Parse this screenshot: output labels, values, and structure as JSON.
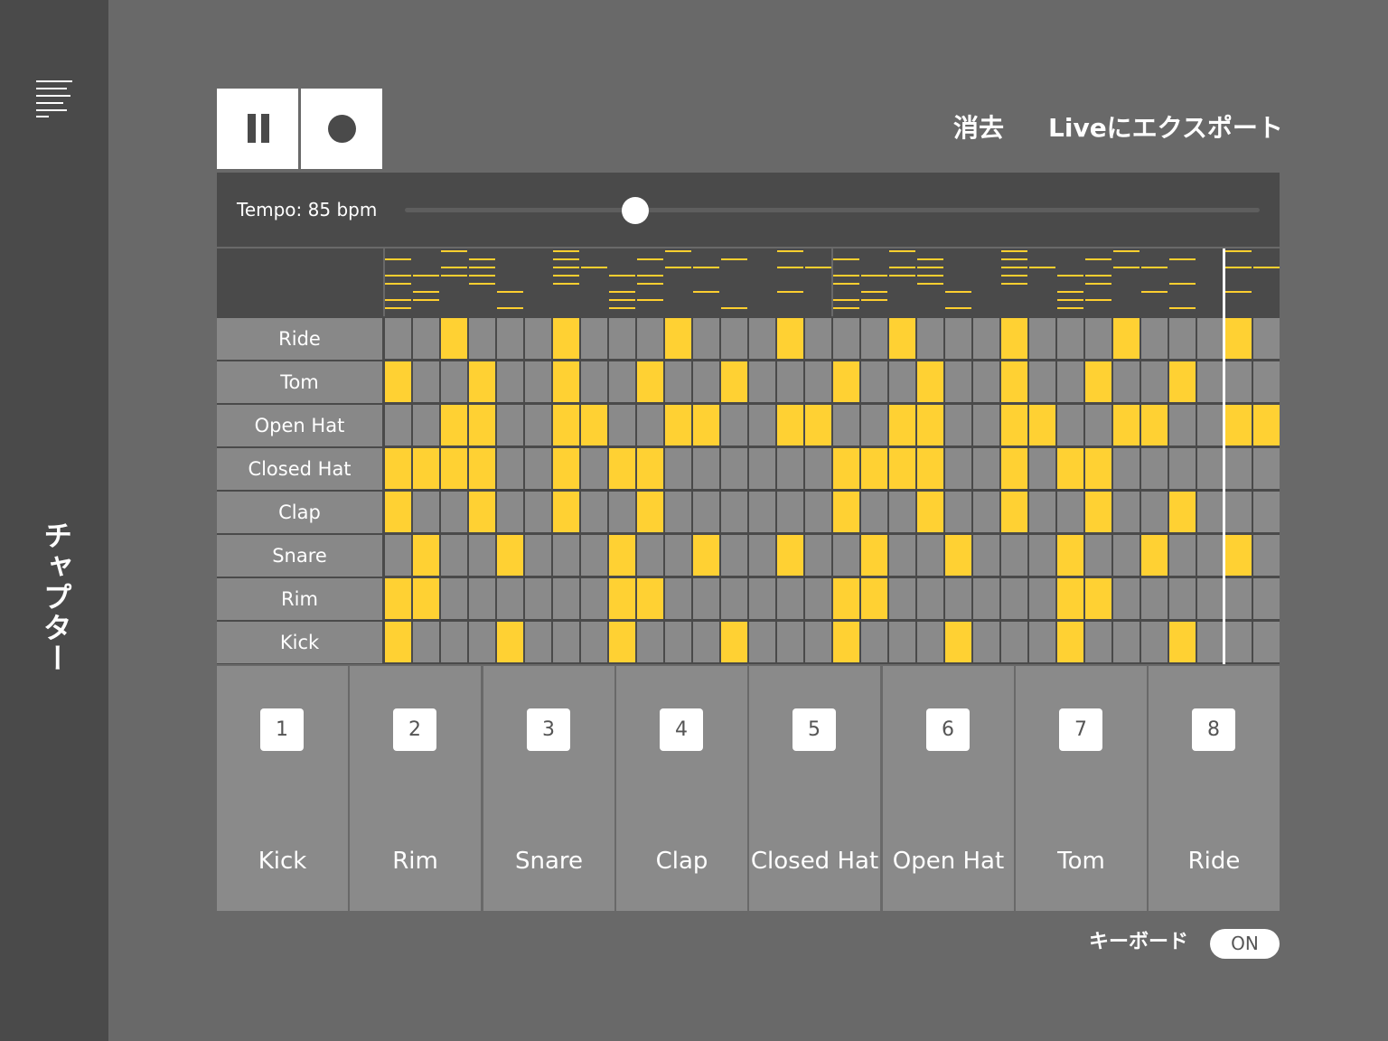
{
  "sidebar": {
    "menu_icon": "menu-icon",
    "chapter_label": "チャプター"
  },
  "transport": {
    "pause_icon": "pause-icon",
    "record_icon": "record-icon"
  },
  "actions": {
    "clear": "消去",
    "export": "Liveにエクスポート"
  },
  "tempo": {
    "label": "Tempo: 85 bpm",
    "value": 85,
    "slider_fraction": 0.27
  },
  "sequencer": {
    "steps": 32,
    "playhead_step": 30,
    "tracks": [
      {
        "name": "Ride",
        "steps": [
          0,
          0,
          1,
          0,
          0,
          0,
          1,
          0,
          0,
          0,
          1,
          0,
          0,
          0,
          1,
          0,
          0,
          0,
          1,
          0,
          0,
          0,
          1,
          0,
          0,
          0,
          1,
          0,
          0,
          0,
          1,
          0
        ]
      },
      {
        "name": "Tom",
        "steps": [
          1,
          0,
          0,
          1,
          0,
          0,
          1,
          0,
          0,
          1,
          0,
          0,
          1,
          0,
          0,
          0,
          1,
          0,
          0,
          1,
          0,
          0,
          1,
          0,
          0,
          1,
          0,
          0,
          1,
          0,
          0,
          0
        ]
      },
      {
        "name": "Open Hat",
        "steps": [
          0,
          0,
          1,
          1,
          0,
          0,
          1,
          1,
          0,
          0,
          1,
          1,
          0,
          0,
          1,
          1,
          0,
          0,
          1,
          1,
          0,
          0,
          1,
          1,
          0,
          0,
          1,
          1,
          0,
          0,
          1,
          1
        ]
      },
      {
        "name": "Closed Hat",
        "steps": [
          1,
          1,
          1,
          1,
          0,
          0,
          1,
          0,
          1,
          1,
          0,
          0,
          0,
          0,
          0,
          0,
          1,
          1,
          1,
          1,
          0,
          0,
          1,
          0,
          1,
          1,
          0,
          0,
          0,
          0,
          0,
          0
        ]
      },
      {
        "name": "Clap",
        "steps": [
          1,
          0,
          0,
          1,
          0,
          0,
          1,
          0,
          0,
          1,
          0,
          0,
          0,
          0,
          0,
          0,
          1,
          0,
          0,
          1,
          0,
          0,
          1,
          0,
          0,
          1,
          0,
          0,
          1,
          0,
          0,
          0
        ]
      },
      {
        "name": "Snare",
        "steps": [
          0,
          1,
          0,
          0,
          1,
          0,
          0,
          0,
          1,
          0,
          0,
          1,
          0,
          0,
          1,
          0,
          0,
          1,
          0,
          0,
          1,
          0,
          0,
          0,
          1,
          0,
          0,
          1,
          0,
          0,
          1,
          0
        ]
      },
      {
        "name": "Rim",
        "steps": [
          1,
          1,
          0,
          0,
          0,
          0,
          0,
          0,
          1,
          1,
          0,
          0,
          0,
          0,
          0,
          0,
          1,
          1,
          0,
          0,
          0,
          0,
          0,
          0,
          1,
          1,
          0,
          0,
          0,
          0,
          0,
          0
        ]
      },
      {
        "name": "Kick",
        "steps": [
          1,
          0,
          0,
          0,
          1,
          0,
          0,
          0,
          1,
          0,
          0,
          0,
          1,
          0,
          0,
          0,
          1,
          0,
          0,
          0,
          1,
          0,
          0,
          0,
          1,
          0,
          0,
          0,
          1,
          0,
          0,
          0
        ]
      }
    ],
    "colors": {
      "active": "#ffd133",
      "inactive": "#8a8a8a",
      "background": "#4a4a4a"
    }
  },
  "pads": [
    {
      "number": "1",
      "label": "Kick"
    },
    {
      "number": "2",
      "label": "Rim"
    },
    {
      "number": "3",
      "label": "Snare"
    },
    {
      "number": "4",
      "label": "Clap"
    },
    {
      "number": "5",
      "label": "Closed Hat"
    },
    {
      "number": "6",
      "label": "Open Hat"
    },
    {
      "number": "7",
      "label": "Tom"
    },
    {
      "number": "8",
      "label": "Ride"
    }
  ],
  "keyboard": {
    "label": "キーボード",
    "toggle": "ON"
  }
}
